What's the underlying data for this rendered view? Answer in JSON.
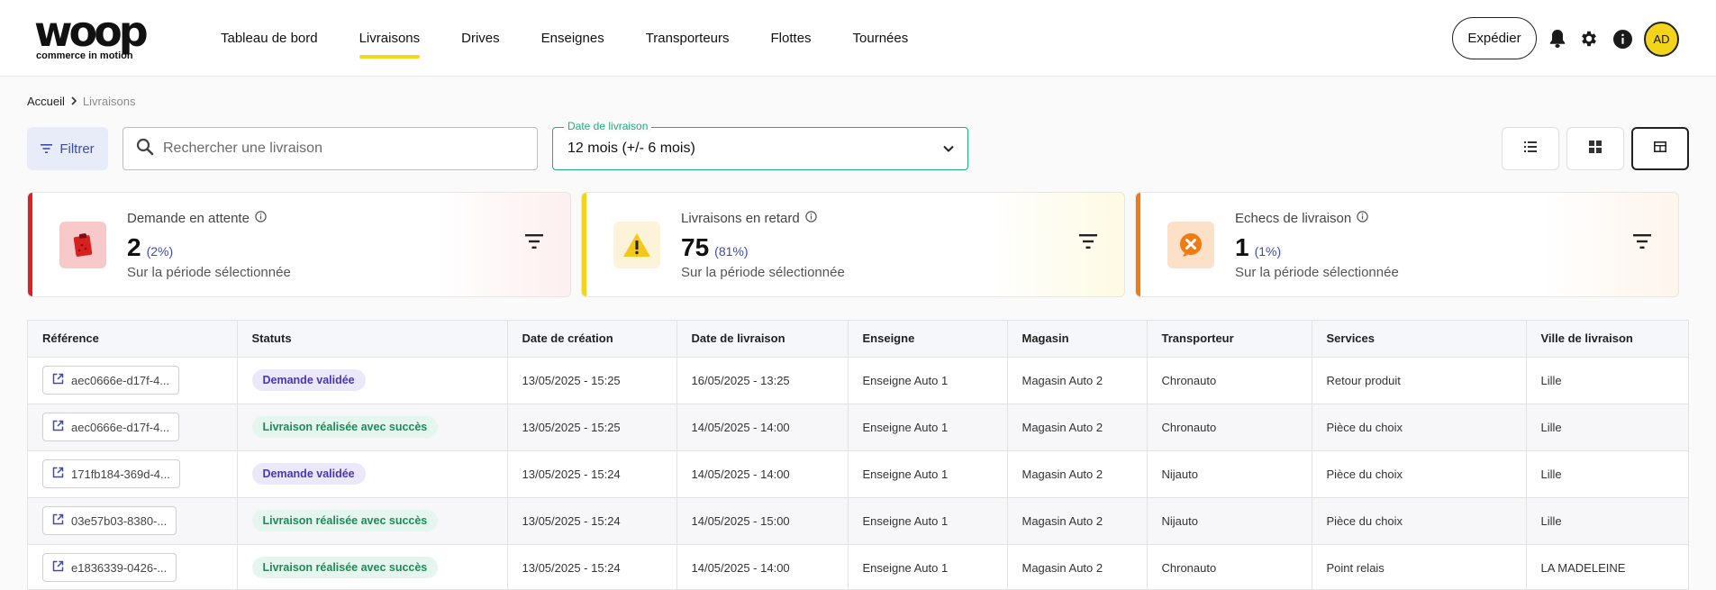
{
  "brand": {
    "logo_word": "woop",
    "logo_tagline": "commerce in motion"
  },
  "nav": {
    "items": [
      {
        "label": "Tableau de bord",
        "active": false
      },
      {
        "label": "Livraisons",
        "active": true
      },
      {
        "label": "Drives",
        "active": false
      },
      {
        "label": "Enseignes",
        "active": false
      },
      {
        "label": "Transporteurs",
        "active": false
      },
      {
        "label": "Flottes",
        "active": false
      },
      {
        "label": "Tournées",
        "active": false
      }
    ],
    "ship_label": "Expédier",
    "avatar_initials": "AD",
    "icons": [
      "bell-icon",
      "gear-icon",
      "info-icon"
    ]
  },
  "breadcrumb": {
    "home": "Accueil",
    "current": "Livraisons"
  },
  "toolbar": {
    "filter_label": "Filtrer",
    "search_placeholder": "Rechercher une livraison",
    "date_label": "Date de livraison",
    "date_value": "12 mois (+/- 6 mois)",
    "views": [
      "list-view-icon",
      "grid-view-icon",
      "table-view-icon"
    ],
    "active_view": "table"
  },
  "kpis": [
    {
      "title": "Demande en attente",
      "value": "2",
      "pct": "(2%)",
      "sub": "Sur la période sélectionnée",
      "accent": "#e02020",
      "icon": "clipboard-icon"
    },
    {
      "title": "Livraisons en retard",
      "value": "75",
      "pct": "(81%)",
      "sub": "Sur la période sélectionnée",
      "accent": "#f2d51a",
      "icon": "warning-icon"
    },
    {
      "title": "Echecs de livraison",
      "value": "1",
      "pct": "(1%)",
      "sub": "Sur la période sélectionnée",
      "accent": "#f07b12",
      "icon": "failure-icon"
    }
  ],
  "table": {
    "columns": [
      "Référence",
      "Statuts",
      "Date de création",
      "Date de livraison",
      "Enseigne",
      "Magasin",
      "Transporteur",
      "Services",
      "Ville de livraison"
    ],
    "rows": [
      {
        "ref": "aec0666e-d17f-4...",
        "status": "Demande validée",
        "status_kind": "violet",
        "created": "13/05/2025 - 15:25",
        "delivery": "16/05/2025 - 13:25",
        "brand": "Enseigne Auto 1",
        "store": "Magasin Auto 2",
        "carrier": "Chronauto",
        "service": "Retour produit",
        "city": "Lille"
      },
      {
        "ref": "aec0666e-d17f-4...",
        "status": "Livraison réalisée avec succès",
        "status_kind": "green",
        "created": "13/05/2025 - 15:25",
        "delivery": "14/05/2025 - 14:00",
        "brand": "Enseigne Auto 1",
        "store": "Magasin Auto 2",
        "carrier": "Chronauto",
        "service": "Pièce du choix",
        "city": "Lille"
      },
      {
        "ref": "171fb184-369d-4...",
        "status": "Demande validée",
        "status_kind": "violet",
        "created": "13/05/2025 - 15:24",
        "delivery": "14/05/2025 - 14:00",
        "brand": "Enseigne Auto 1",
        "store": "Magasin Auto 2",
        "carrier": "Nijauto",
        "service": "Pièce du choix",
        "city": "Lille"
      },
      {
        "ref": "03e57b03-8380-...",
        "status": "Livraison réalisée avec succès",
        "status_kind": "green",
        "created": "13/05/2025 - 15:24",
        "delivery": "14/05/2025 - 15:00",
        "brand": "Enseigne Auto 1",
        "store": "Magasin Auto 2",
        "carrier": "Nijauto",
        "service": "Pièce du choix",
        "city": "Lille"
      },
      {
        "ref": "e1836339-0426-...",
        "status": "Livraison réalisée avec succès",
        "status_kind": "green",
        "created": "13/05/2025 - 15:24",
        "delivery": "14/05/2025 - 14:00",
        "brand": "Enseigne Auto 1",
        "store": "Magasin Auto 2",
        "carrier": "Chronauto",
        "service": "Point relais",
        "city": "LA MADELEINE"
      }
    ]
  }
}
